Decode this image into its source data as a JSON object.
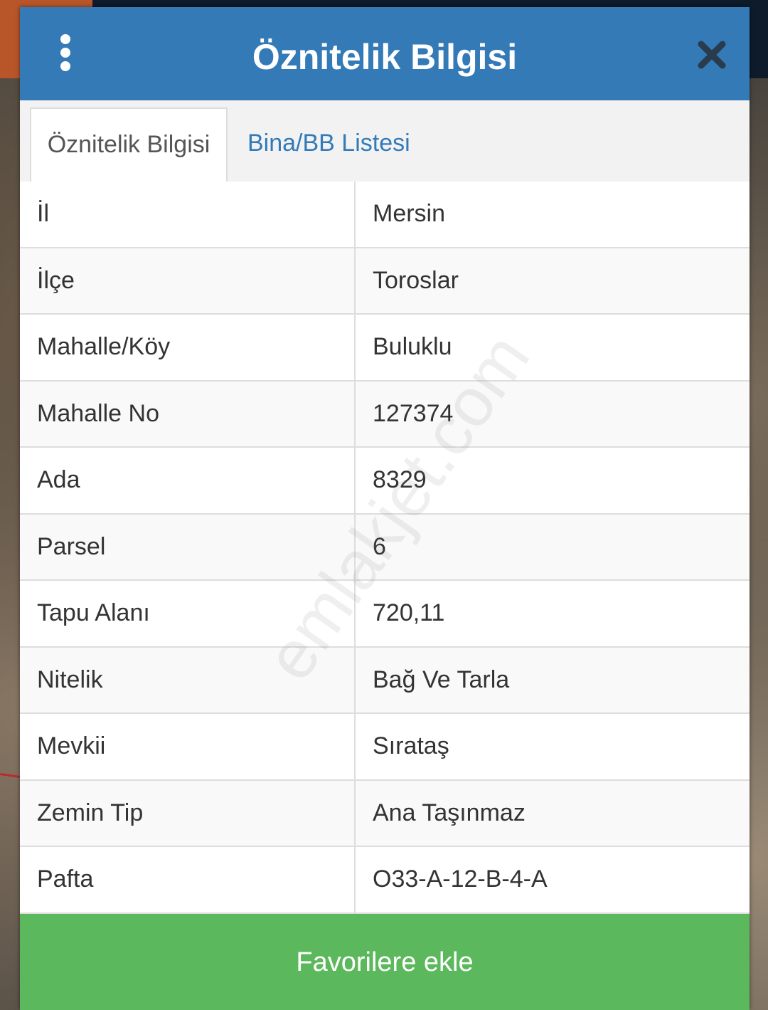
{
  "dialog": {
    "title": "Öznitelik Bilgisi",
    "menu_icon": "more-vertical-icon",
    "close_icon": "close-icon"
  },
  "tabs": [
    {
      "label": "Öznitelik Bilgisi",
      "active": true
    },
    {
      "label": "Bina/BB Listesi",
      "active": false
    }
  ],
  "attributes": [
    {
      "key": "İl",
      "value": "Mersin"
    },
    {
      "key": "İlçe",
      "value": "Toroslar"
    },
    {
      "key": "Mahalle/Köy",
      "value": "Buluklu"
    },
    {
      "key": "Mahalle No",
      "value": "127374"
    },
    {
      "key": "Ada",
      "value": "8329"
    },
    {
      "key": "Parsel",
      "value": "6"
    },
    {
      "key": "Tapu Alanı",
      "value": "720,11"
    },
    {
      "key": "Nitelik",
      "value": "Bağ Ve Tarla"
    },
    {
      "key": "Mevkii",
      "value": "Sırataş"
    },
    {
      "key": "Zemin Tip",
      "value": "Ana Taşınmaz"
    },
    {
      "key": "Pafta",
      "value": "O33-A-12-B-4-A"
    }
  ],
  "footer": {
    "button_label": "Favorilere ekle"
  },
  "watermark": "emlakjet.com",
  "colors": {
    "header": "#337ab7",
    "tab_link": "#337ab7",
    "button": "#5cb85c"
  }
}
